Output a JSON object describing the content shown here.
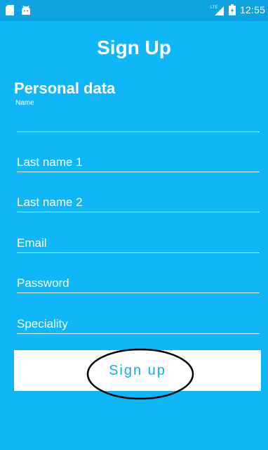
{
  "status_bar": {
    "left_icons": [
      "sd-card-icon",
      "android-icon"
    ],
    "network": "LTE",
    "time": "12:55"
  },
  "page": {
    "title": "Sign Up",
    "section_title": "Personal data"
  },
  "form": {
    "name": {
      "label": "Name",
      "value": "",
      "placeholder": ""
    },
    "last_name_1": {
      "value": "",
      "placeholder": "Last name 1"
    },
    "last_name_2": {
      "value": "",
      "placeholder": "Last name 2"
    },
    "email": {
      "value": "",
      "placeholder": "Email"
    },
    "password": {
      "value": "",
      "placeholder": "Password"
    },
    "speciality": {
      "value": "",
      "placeholder": "Speciality"
    }
  },
  "actions": {
    "signup_label": "Sign up"
  },
  "colors": {
    "background": "#0fb7f9",
    "status_bar": "#0fa2e0",
    "button_bg": "#ffffff",
    "button_text": "#14aef0"
  }
}
